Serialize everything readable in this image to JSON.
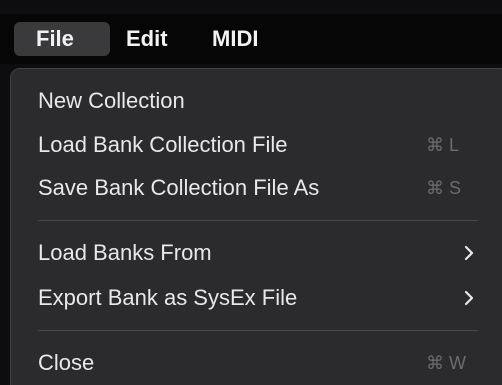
{
  "menubar": {
    "items": [
      {
        "label": "File",
        "active": true
      },
      {
        "label": "Edit",
        "active": false
      },
      {
        "label": "MIDI",
        "active": false
      }
    ]
  },
  "file_menu": {
    "items": [
      {
        "label": "New Collection",
        "shortcut": ""
      },
      {
        "label": "Load Bank Collection File",
        "shortcut": "⌘ L"
      },
      {
        "label": "Save Bank Collection File As",
        "shortcut": "⌘ S"
      },
      {
        "label": "Load Banks From",
        "submenu_icon": "chevron-right-icon"
      },
      {
        "label": "Export Bank as SysEx File",
        "submenu_icon": "chevron-right-icon"
      },
      {
        "label": "Close",
        "shortcut": "⌘ W"
      }
    ]
  },
  "colors": {
    "menubar_bg": "#060607",
    "menu_bg": "#2b2b2e",
    "active_item_bg": "#3a3a3d",
    "text": "#e8e8ea",
    "shortcut_text": "#6b6b70",
    "separator": "#48484c"
  }
}
